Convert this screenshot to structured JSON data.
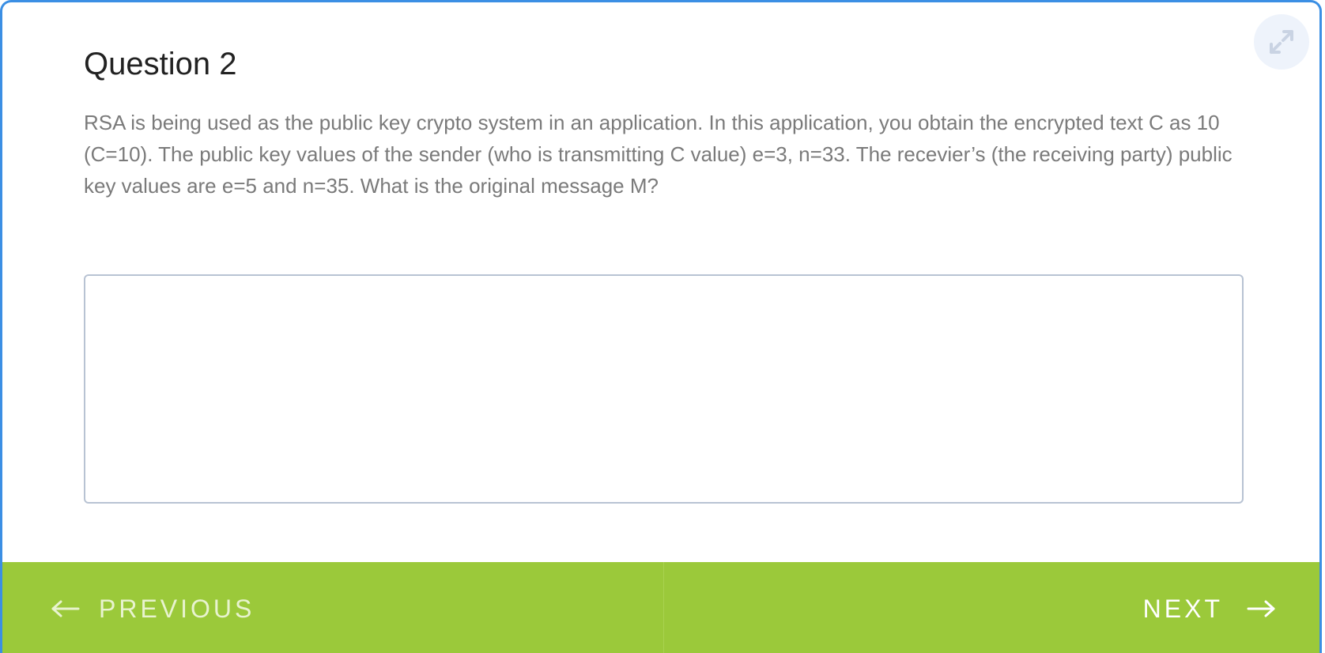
{
  "question": {
    "title": "Question 2",
    "prompt": "RSA is being used as the public key crypto system in an application. In this application, you obtain the encrypted text C as 10 (C=10). The public key values of the sender (who is transmitting C value) e=3, n=33. The recevier’s (the receiving party) public key values are e=5 and n=35. What is the original message M?"
  },
  "answer": {
    "value": "",
    "placeholder": ""
  },
  "navigation": {
    "previous_label": "PREVIOUS",
    "next_label": "NEXT"
  },
  "icons": {
    "expand": "expand-icon",
    "previous": "arrow-left-icon",
    "next": "arrow-right-icon"
  },
  "colors": {
    "footer": "#9bc93a",
    "border_accent": "#3b8fe4"
  }
}
